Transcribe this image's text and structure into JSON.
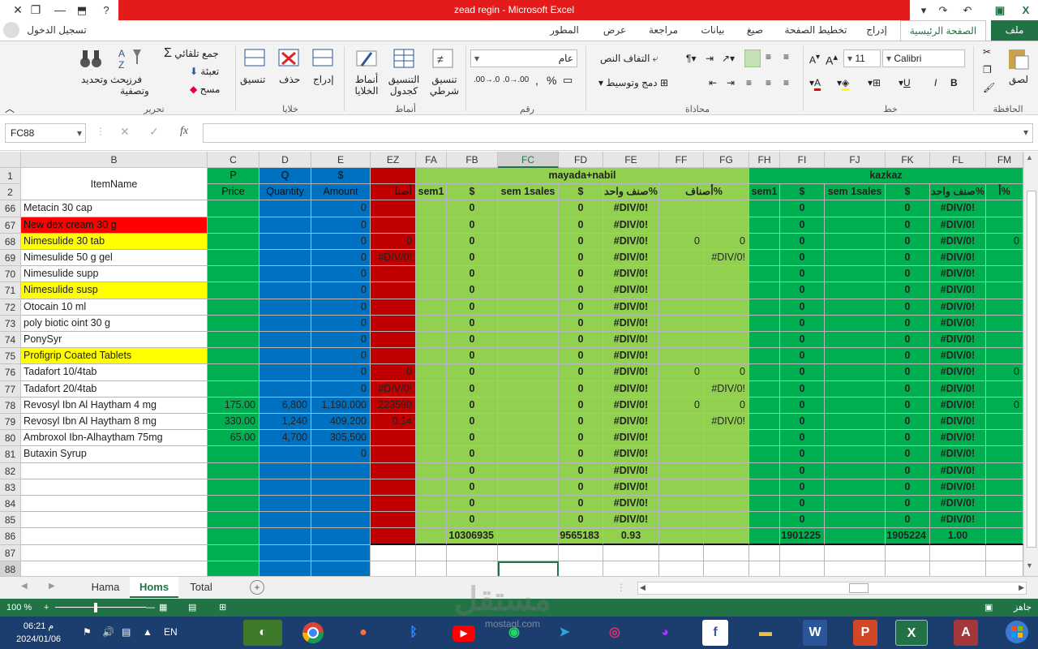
{
  "window": {
    "title": "zead regin  -  Microsoft Excel"
  },
  "login": {
    "label": "تسجيل الدخول"
  },
  "ribbon_tabs": [
    "ملف",
    "الصفحة الرئيسية",
    "إدراج",
    "تخطيط الصفحة",
    "صيغ",
    "بيانات",
    "مراجعة",
    "عرض",
    "المطور"
  ],
  "ribbon": {
    "clipboard": {
      "paste": "لصق",
      "group": "الحافظة"
    },
    "font": {
      "name": "Calibri",
      "size": "11",
      "group": "خط",
      "bold": "B",
      "italic": "I",
      "underline": "U"
    },
    "alignment": {
      "wrap": "التفاف النص",
      "merge": "دمج وتوسيط",
      "group": "محاذاة"
    },
    "number": {
      "format": "عام",
      "group": "رقم"
    },
    "styles": {
      "conditional": "تنسيق شرطي",
      "table": "التنسيق كجدول",
      "cell": "أنماط الخلايا",
      "group": "أنماط"
    },
    "cells": {
      "insert": "إدراج",
      "delete": "حذف",
      "format": "تنسيق",
      "group": "خلايا"
    },
    "editing": {
      "autosum": "جمع تلقائي",
      "fill": "تعبئة",
      "clear": "مسح",
      "sort": "فرز وتصفية",
      "find": "بحث وتحديد",
      "group": "تحرير"
    }
  },
  "formula_bar": {
    "name_box": "FC88",
    "fx": "fx",
    "value": ""
  },
  "columns": [
    "B",
    "C",
    "D",
    "E",
    "EZ",
    "FA",
    "FB",
    "FC",
    "FD",
    "FE",
    "FF",
    "FG",
    "FH",
    "FI",
    "FJ",
    "FK",
    "FL",
    "FM"
  ],
  "selected_column": "FC",
  "header_rows": {
    "row1": {
      "B": "ItemName",
      "C": "P",
      "D": "Q",
      "E": "$",
      "FA_group": "mayada+nabil",
      "FH_group": "kazkaz"
    },
    "row2": {
      "C": "Price",
      "D": "Quantity",
      "E": "Amount",
      "EZ": "أصنا",
      "FA": "sem1",
      "FB": "$",
      "FC": "sem 1sales",
      "FD": "$",
      "FE": "صنف واحد%",
      "FF": "أصناف%",
      "FH": "sem1",
      "FI": "$",
      "FJ": "sem 1sales",
      "FK": "$",
      "FL": "صنف واحد%",
      "FM": "أ%"
    }
  },
  "rows": [
    {
      "n": "66",
      "B": "Metacin 30 cap",
      "E": "0",
      "FB": "0",
      "FD": "0",
      "FE": "#DIV/0!",
      "FI": "0",
      "FK": "0",
      "FL": "#DIV/0!"
    },
    {
      "n": "67",
      "B": "New dex cream 30 g",
      "E": "0",
      "FB": "0",
      "FD": "0",
      "FE": "#DIV/0!",
      "FI": "0",
      "FK": "0",
      "FL": "#DIV/0!"
    },
    {
      "n": "68",
      "B": "Nimesulide  30 tab",
      "E": "0",
      "EZ": "0",
      "FB": "0",
      "FD": "0",
      "FE": "#DIV/0!",
      "FF": "0",
      "FG": "0",
      "FI": "0",
      "FK": "0",
      "FL": "#DIV/0!",
      "FM": "0"
    },
    {
      "n": "69",
      "B": "Nimesulide 50 g gel",
      "E": "0",
      "EZ": "#DIV/0!",
      "FB": "0",
      "FD": "0",
      "FE": "#DIV/0!",
      "FG": "#DIV/0!",
      "FI": "0",
      "FK": "0",
      "FL": "#DIV/0!"
    },
    {
      "n": "70",
      "B": "Nimesulide supp",
      "E": "0",
      "FB": "0",
      "FD": "0",
      "FE": "#DIV/0!",
      "FI": "0",
      "FK": "0",
      "FL": "#DIV/0!"
    },
    {
      "n": "71",
      "B": "Nimesulide susp",
      "E": "0",
      "FB": "0",
      "FD": "0",
      "FE": "#DIV/0!",
      "FI": "0",
      "FK": "0",
      "FL": "#DIV/0!"
    },
    {
      "n": "72",
      "B": "Otocain 10 ml",
      "E": "0",
      "FB": "0",
      "FD": "0",
      "FE": "#DIV/0!",
      "FI": "0",
      "FK": "0",
      "FL": "#DIV/0!"
    },
    {
      "n": "73",
      "B": "poly biotic oint 30 g",
      "E": "0",
      "FB": "0",
      "FD": "0",
      "FE": "#DIV/0!",
      "FI": "0",
      "FK": "0",
      "FL": "#DIV/0!"
    },
    {
      "n": "74",
      "B": "PonySyr",
      "E": "0",
      "FB": "0",
      "FD": "0",
      "FE": "#DIV/0!",
      "FI": "0",
      "FK": "0",
      "FL": "#DIV/0!"
    },
    {
      "n": "75",
      "B": "Profigrip Coated Tablets",
      "E": "0",
      "FB": "0",
      "FD": "0",
      "FE": "#DIV/0!",
      "FI": "0",
      "FK": "0",
      "FL": "#DIV/0!"
    },
    {
      "n": "76",
      "B": "Tadafort 10/4tab",
      "E": "0",
      "EZ": "0",
      "FB": "0",
      "FD": "0",
      "FE": "#DIV/0!",
      "FF": "0",
      "FG": "0",
      "FI": "0",
      "FK": "0",
      "FL": "#DIV/0!",
      "FM": "0"
    },
    {
      "n": "77",
      "B": "Tadafort 20/4tab",
      "E": "0",
      "EZ": "#DIV/0!",
      "FB": "0",
      "FD": "0",
      "FE": "#DIV/0!",
      "FG": "#DIV/0!",
      "FI": "0",
      "FK": "0",
      "FL": "#DIV/0!"
    },
    {
      "n": "78",
      "B": "Revosyl Ibn Al Haytham 4 mg",
      "C": "175.00",
      "D": "6,800",
      "E": "1,190,000",
      "EZ": "223590",
      "FB": "0",
      "FD": "0",
      "FE": "#DIV/0!",
      "FF": "0",
      "FG": "0",
      "FI": "0",
      "FK": "0",
      "FL": "#DIV/0!",
      "FM": "0"
    },
    {
      "n": "79",
      "B": "Revosyl Ibn Al Haytham 8 mg",
      "C": "330.00",
      "D": "1,240",
      "E": "409,200",
      "EZ": "0.14",
      "FB": "0",
      "FD": "0",
      "FE": "#DIV/0!",
      "FG": "#DIV/0!",
      "FI": "0",
      "FK": "0",
      "FL": "#DIV/0!"
    },
    {
      "n": "80",
      "B": "Ambroxol Ibn-Alhaytham 75mg",
      "C": "65.00",
      "D": "4,700",
      "E": "305,500",
      "FB": "0",
      "FD": "0",
      "FE": "#DIV/0!",
      "FI": "0",
      "FK": "0",
      "FL": "#DIV/0!"
    },
    {
      "n": "81",
      "B": "Butaxin Syrup",
      "E": "0",
      "FB": "0",
      "FD": "0",
      "FE": "#DIV/0!",
      "FI": "0",
      "FK": "0",
      "FL": "#DIV/0!"
    },
    {
      "n": "82",
      "FB": "0",
      "FD": "0",
      "FE": "#DIV/0!",
      "FI": "0",
      "FK": "0",
      "FL": "#DIV/0!"
    },
    {
      "n": "83",
      "FB": "0",
      "FD": "0",
      "FE": "#DIV/0!",
      "FI": "0",
      "FK": "0",
      "FL": "#DIV/0!"
    },
    {
      "n": "84",
      "FB": "0",
      "FD": "0",
      "FE": "#DIV/0!",
      "FI": "0",
      "FK": "0",
      "FL": "#DIV/0!"
    },
    {
      "n": "85",
      "FB": "0",
      "FD": "0",
      "FE": "#DIV/0!",
      "FI": "0",
      "FK": "0",
      "FL": "#DIV/0!"
    },
    {
      "n": "86",
      "FB": "10306935",
      "FD": "9565183",
      "FE": "0.93",
      "FI": "1901225",
      "FK": "1905224",
      "FL": "1.00"
    },
    {
      "n": "87"
    },
    {
      "n": "88"
    }
  ],
  "sheets": [
    "Hama",
    "Homs",
    "Total"
  ],
  "active_sheet": "Homs",
  "status": {
    "ready": "جاهز",
    "zoom": "100 %"
  },
  "taskbar": {
    "time": "06:21 م",
    "date": "2024/01/06",
    "lang": "EN"
  },
  "watermark": {
    "brand": "مستقل",
    "url": "mostaql.com"
  },
  "colors": {
    "excel_green": "#217346",
    "title_red": "#e31b1b",
    "light_green": "#92d050",
    "dark_green": "#00b050",
    "blue": "#0070c0",
    "red": "#c00000",
    "yellow": "#ffff00"
  }
}
